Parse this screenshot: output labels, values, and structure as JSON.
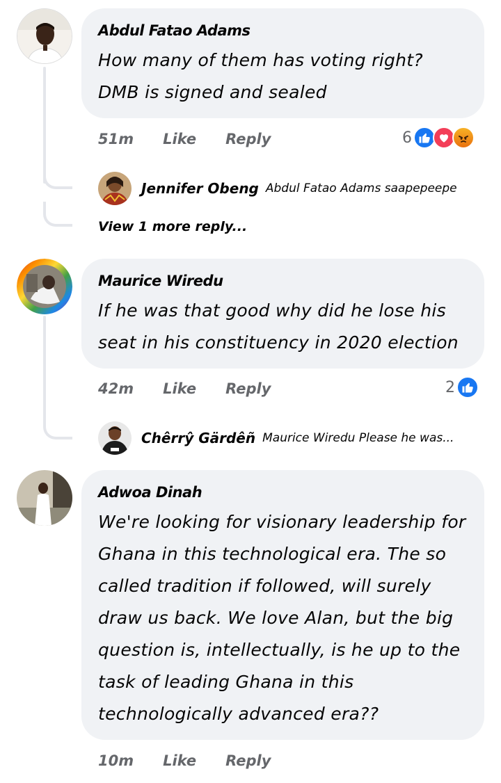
{
  "comments": [
    {
      "author": "Abdul Fatao Adams",
      "text": "How many of them has voting right? DMB is signed and sealed",
      "time": "51m",
      "like_label": "Like",
      "reply_label": "Reply",
      "reaction_count": "6",
      "reactions": [
        "like-icon",
        "love-icon",
        "angry-icon"
      ],
      "reply_preview": {
        "author": "Jennifer Obeng",
        "text": "Abdul Fatao Adams saapepeepe"
      },
      "view_more": "View 1 more reply..."
    },
    {
      "author": "Maurice Wiredu",
      "text": "If he was that good why did he lose his seat in his constituency in 2020 election",
      "time": "42m",
      "like_label": "Like",
      "reply_label": "Reply",
      "reaction_count": "2",
      "reactions": [
        "like-icon"
      ],
      "reply_preview": {
        "author": "Chêrrŷ Gärdêñ",
        "text": "Maurice Wiredu Please he was..."
      }
    },
    {
      "author": "Adwoa Dinah",
      "text": "We're looking for visionary leadership for Ghana in this technological era. The so called tradition if followed, will surely draw us back. We love Alan, but the big question is, intellectually, is he up to the task of leading Ghana in this technologically advanced era??",
      "time": "10m",
      "like_label": "Like",
      "reply_label": "Reply"
    }
  ],
  "colors": {
    "bubble": "#f0f2f5",
    "meta_text": "#65676b",
    "like_blue": "#1877f2",
    "love_red": "#f33e58"
  }
}
